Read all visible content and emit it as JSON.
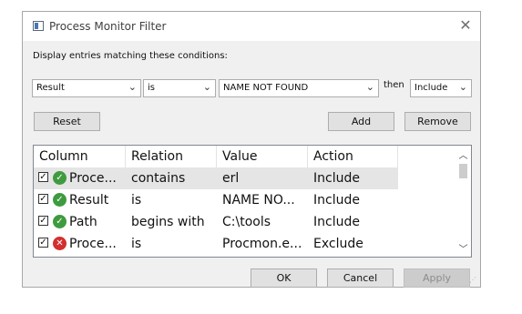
{
  "window": {
    "title": "Process Monitor Filter",
    "close_glyph": "✕"
  },
  "conditions": {
    "label": "Display entries matching these conditions:",
    "column_value": "Result",
    "relation_value": "is",
    "value_value": "NAME NOT FOUND",
    "then_label": "then",
    "action_value": "Include"
  },
  "buttons": {
    "reset": "Reset",
    "add": "Add",
    "remove": "Remove",
    "ok": "OK",
    "cancel": "Cancel",
    "apply": "Apply"
  },
  "list": {
    "headers": [
      "Column",
      "Relation",
      "Value",
      "Action"
    ],
    "rows": [
      {
        "column": "Proce...",
        "relation": "contains",
        "value": "erl",
        "action": "Include",
        "checked": "☑",
        "icon": "gear-process-icon",
        "icon_color": "#3f9b3f",
        "selected": true
      },
      {
        "column": "Result",
        "relation": "is",
        "value": "NAME NO...",
        "action": "Include",
        "checked": "☑",
        "icon": "check-circle-icon",
        "icon_color": "#3f9b3f",
        "selected": false
      },
      {
        "column": "Path",
        "relation": "begins with",
        "value": "C:\\tools",
        "action": "Include",
        "checked": "☑",
        "icon": "check-circle-icon",
        "icon_color": "#3f9b3f",
        "selected": false
      },
      {
        "column": "Proce...",
        "relation": "is",
        "value": "Procmon.e...",
        "action": "Exclude",
        "checked": "☑",
        "icon": "x-circle-icon",
        "icon_color": "#d32f2f",
        "selected": false
      }
    ]
  },
  "colors": {
    "include": "#3f9b3f",
    "exclude": "#d32f2f",
    "selected_row": "#e5e5e5"
  }
}
